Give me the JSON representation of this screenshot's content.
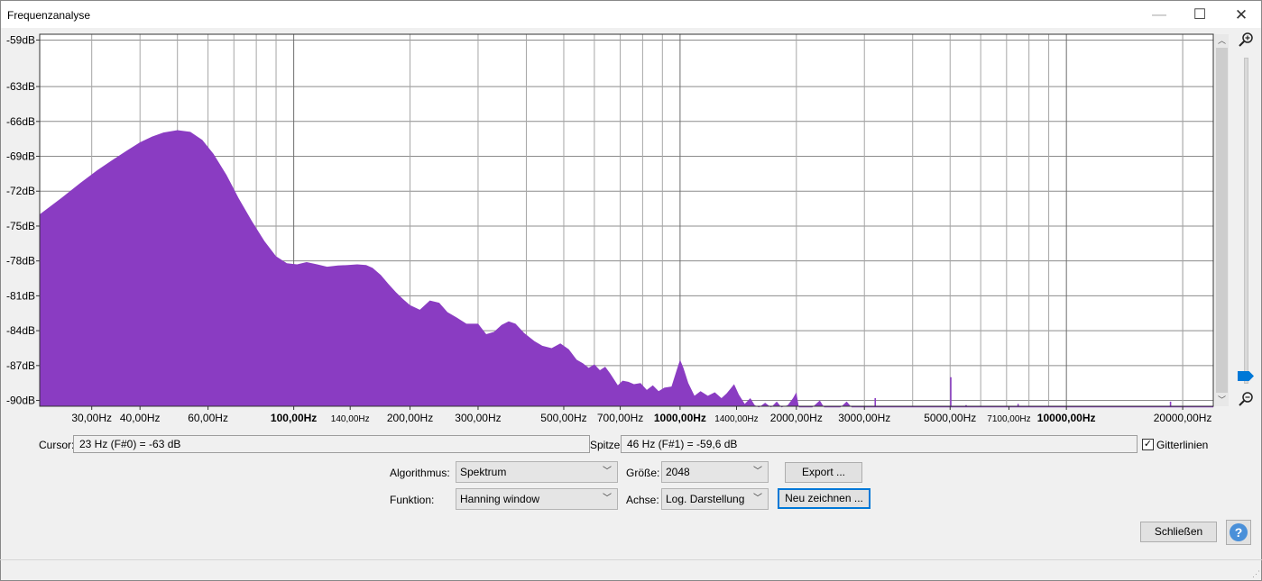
{
  "window": {
    "title": "Frequenzanalyse",
    "minimize": "—",
    "maximize": "☐",
    "close": "✕"
  },
  "chart_data": {
    "type": "area",
    "color": "#8a3cc2",
    "x_scale": "log",
    "xlim": [
      22,
      24000
    ],
    "ylim": [
      -90.5,
      -58.5
    ],
    "ytick_labels": [
      "-59dB",
      "-63dB",
      "-66dB",
      "-69dB",
      "-72dB",
      "-75dB",
      "-78dB",
      "-81dB",
      "-84dB",
      "-87dB",
      "-90dB"
    ],
    "yticks": [
      -59,
      -63,
      -66,
      -69,
      -72,
      -75,
      -78,
      -81,
      -84,
      -87,
      -90
    ],
    "xtick_labels": [
      "30,00Hz",
      "40,00Hz",
      "60,00Hz",
      "100,00Hz",
      "140,00Hz",
      "200,00Hz",
      "300,00Hz",
      "500,00Hz",
      "700,00Hz",
      "1000,00Hz",
      "1400,00Hz",
      "2000,00Hz",
      "3000,00Hz",
      "5000,00Hz",
      "7100,00Hz",
      "10000,00Hz",
      "20000,00Hz"
    ],
    "xticks": [
      30,
      40,
      60,
      100,
      140,
      200,
      300,
      500,
      700,
      1000,
      1400,
      2000,
      3000,
      5000,
      7100,
      10000,
      20000
    ],
    "xtick_bold": [
      false,
      false,
      false,
      true,
      false,
      false,
      false,
      false,
      false,
      true,
      false,
      false,
      false,
      false,
      false,
      true,
      false
    ],
    "xtick_small": [
      false,
      false,
      false,
      false,
      true,
      false,
      false,
      false,
      false,
      false,
      true,
      false,
      false,
      false,
      true,
      false,
      false
    ],
    "grid": true,
    "points": [
      [
        22,
        -74
      ],
      [
        25,
        -72.6
      ],
      [
        28,
        -71.3
      ],
      [
        31,
        -70.2
      ],
      [
        34,
        -69.3
      ],
      [
        37,
        -68.5
      ],
      [
        40,
        -67.8
      ],
      [
        43,
        -67.3
      ],
      [
        46,
        -66.95
      ],
      [
        50,
        -66.75
      ],
      [
        54,
        -66.9
      ],
      [
        58,
        -67.6
      ],
      [
        62,
        -68.8
      ],
      [
        67,
        -70.6
      ],
      [
        72,
        -72.6
      ],
      [
        78,
        -74.6
      ],
      [
        84,
        -76.3
      ],
      [
        90,
        -77.6
      ],
      [
        96,
        -78.2
      ],
      [
        102,
        -78.3
      ],
      [
        108,
        -78.1
      ],
      [
        115,
        -78.3
      ],
      [
        122,
        -78.5
      ],
      [
        130,
        -78.4
      ],
      [
        138,
        -78.35
      ],
      [
        146,
        -78.3
      ],
      [
        154,
        -78.35
      ],
      [
        160,
        -78.6
      ],
      [
        168,
        -79.2
      ],
      [
        176,
        -80.0
      ],
      [
        184,
        -80.7
      ],
      [
        192,
        -81.3
      ],
      [
        200,
        -81.8
      ],
      [
        212,
        -82.2
      ],
      [
        225,
        -81.4
      ],
      [
        238,
        -81.6
      ],
      [
        250,
        -82.4
      ],
      [
        265,
        -82.9
      ],
      [
        280,
        -83.4
      ],
      [
        300,
        -83.4
      ],
      [
        315,
        -84.3
      ],
      [
        330,
        -84.1
      ],
      [
        345,
        -83.5
      ],
      [
        360,
        -83.2
      ],
      [
        375,
        -83.4
      ],
      [
        395,
        -84.2
      ],
      [
        420,
        -84.9
      ],
      [
        440,
        -85.3
      ],
      [
        465,
        -85.5
      ],
      [
        490,
        -85.1
      ],
      [
        515,
        -85.6
      ],
      [
        540,
        -86.5
      ],
      [
        560,
        -86.8
      ],
      [
        580,
        -87.2
      ],
      [
        600,
        -86.9
      ],
      [
        620,
        -87.4
      ],
      [
        640,
        -87.1
      ],
      [
        660,
        -87.7
      ],
      [
        690,
        -88.7
      ],
      [
        710,
        -88.3
      ],
      [
        735,
        -88.4
      ],
      [
        760,
        -88.6
      ],
      [
        790,
        -88.5
      ],
      [
        820,
        -89.1
      ],
      [
        850,
        -88.7
      ],
      [
        880,
        -89.2
      ],
      [
        910,
        -88.9
      ],
      [
        950,
        -88.8
      ],
      [
        980,
        -87.4
      ],
      [
        1000,
        -86.5
      ],
      [
        1020,
        -87.2
      ],
      [
        1050,
        -88.5
      ],
      [
        1090,
        -89.6
      ],
      [
        1130,
        -89.2
      ],
      [
        1180,
        -89.6
      ],
      [
        1230,
        -89.3
      ],
      [
        1280,
        -89.8
      ],
      [
        1320,
        -89.4
      ],
      [
        1350,
        -89.0
      ],
      [
        1380,
        -88.6
      ],
      [
        1420,
        -89.5
      ],
      [
        1470,
        -90.3
      ],
      [
        1520,
        -89.8
      ],
      [
        1560,
        -90.4
      ],
      [
        1600,
        -90.6
      ],
      [
        1660,
        -90.2
      ],
      [
        1720,
        -90.6
      ],
      [
        1780,
        -90.1
      ],
      [
        1830,
        -90.6
      ],
      [
        1900,
        -90.4
      ],
      [
        1960,
        -89.8
      ],
      [
        2000,
        -89.3
      ],
      [
        2030,
        -90.6
      ],
      [
        2200,
        -90.6
      ],
      [
        2300,
        -90.0
      ],
      [
        2360,
        -90.6
      ],
      [
        2600,
        -90.6
      ],
      [
        2700,
        -90.1
      ],
      [
        2780,
        -90.6
      ],
      [
        24000,
        -90.6
      ]
    ],
    "spikes": [
      [
        3200,
        -89.8
      ],
      [
        5020,
        -88.0
      ],
      [
        5500,
        -90.4
      ],
      [
        6100,
        -90.5
      ],
      [
        7500,
        -90.3
      ],
      [
        18600,
        -90.1
      ]
    ],
    "cursor": {
      "label": "Cursor:",
      "value": "23 Hz (F#0) = -63 dB"
    },
    "peak": {
      "label": "Spitze:",
      "value": "46 Hz (F#1) = -59,6 dB"
    }
  },
  "controls": {
    "gridlines_label": "Gitterlinien",
    "gridlines_checked": true,
    "algorithm_label": "Algorithmus:",
    "algorithm_value": "Spektrum",
    "size_label": "Größe:",
    "size_value": "2048",
    "export_label": "Export ...",
    "function_label": "Funktion:",
    "function_value": "Hanning window",
    "axis_label": "Achse:",
    "axis_value": "Log. Darstellung",
    "redraw_label": "Neu zeichnen ...",
    "close_label": "Schließen",
    "help_label": "?"
  },
  "zoom": {
    "level": 0.0
  },
  "icons": {
    "zoom_in": "zoom-in-icon",
    "zoom_out": "zoom-out-icon"
  }
}
